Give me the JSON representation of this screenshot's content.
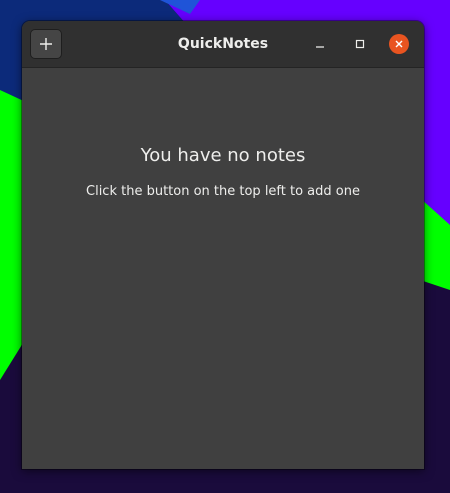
{
  "window": {
    "title": "QuickNotes"
  },
  "toolbar": {
    "add_button_icon": "plus-icon"
  },
  "window_controls": {
    "minimize_icon": "minimize-icon",
    "maximize_icon": "maximize-icon",
    "close_icon": "close-icon"
  },
  "empty_state": {
    "title": "You have no notes",
    "hint": "Click the button on the top left to add one"
  },
  "colors": {
    "titlebar": "#303030",
    "window_background": "#404040",
    "close_button": "#e95420",
    "text": "#eeeeec",
    "wallpaper_green": "#00ff00",
    "wallpaper_purple": "#6600ff",
    "wallpaper_dark": "#1a0b3c",
    "wallpaper_blue": "#0c2a7a"
  }
}
